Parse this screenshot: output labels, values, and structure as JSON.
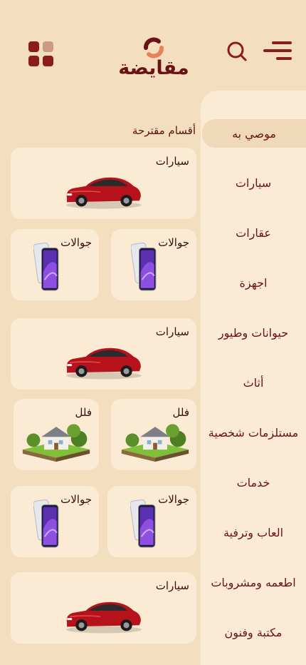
{
  "header": {
    "logo_text": "مقايضة",
    "icons": [
      "grid-icon",
      "logo-mark-icon",
      "search-icon",
      "menu-icon"
    ]
  },
  "sidebar": {
    "items": [
      {
        "label": "موصي به",
        "active": true
      },
      {
        "label": "سيارات",
        "active": false
      },
      {
        "label": "عقارات",
        "active": false
      },
      {
        "label": "اجهزة",
        "active": false
      },
      {
        "label": "حيوانات وطيور",
        "active": false
      },
      {
        "label": "أثاث",
        "active": false
      },
      {
        "label": "مستلزمات شخصية",
        "active": false
      },
      {
        "label": "خدمات",
        "active": false
      },
      {
        "label": "العاب وترفية",
        "active": false
      },
      {
        "label": "اطعمه ومشروبات",
        "active": false
      },
      {
        "label": "مكتبة وفنون",
        "active": false
      }
    ]
  },
  "main": {
    "section_title": "أقسام مقترحة",
    "cards": [
      {
        "label": "سيارات",
        "image": "car-image"
      },
      {
        "label": "جوالات",
        "image": "phone-image"
      },
      {
        "label": "جوالات",
        "image": "phone-image"
      },
      {
        "label": "سيارات",
        "image": "car-image"
      },
      {
        "label": "فلل",
        "image": "villa-image"
      },
      {
        "label": "فلل",
        "image": "villa-image"
      },
      {
        "label": "جوالات",
        "image": "phone-image"
      },
      {
        "label": "جوالات",
        "image": "phone-image"
      },
      {
        "label": "سيارات",
        "image": "car-image"
      }
    ]
  },
  "colors": {
    "background": "#f3dfbf",
    "card": "#fbebd5",
    "accent": "#8a1d1a",
    "text": "#6b1214"
  }
}
